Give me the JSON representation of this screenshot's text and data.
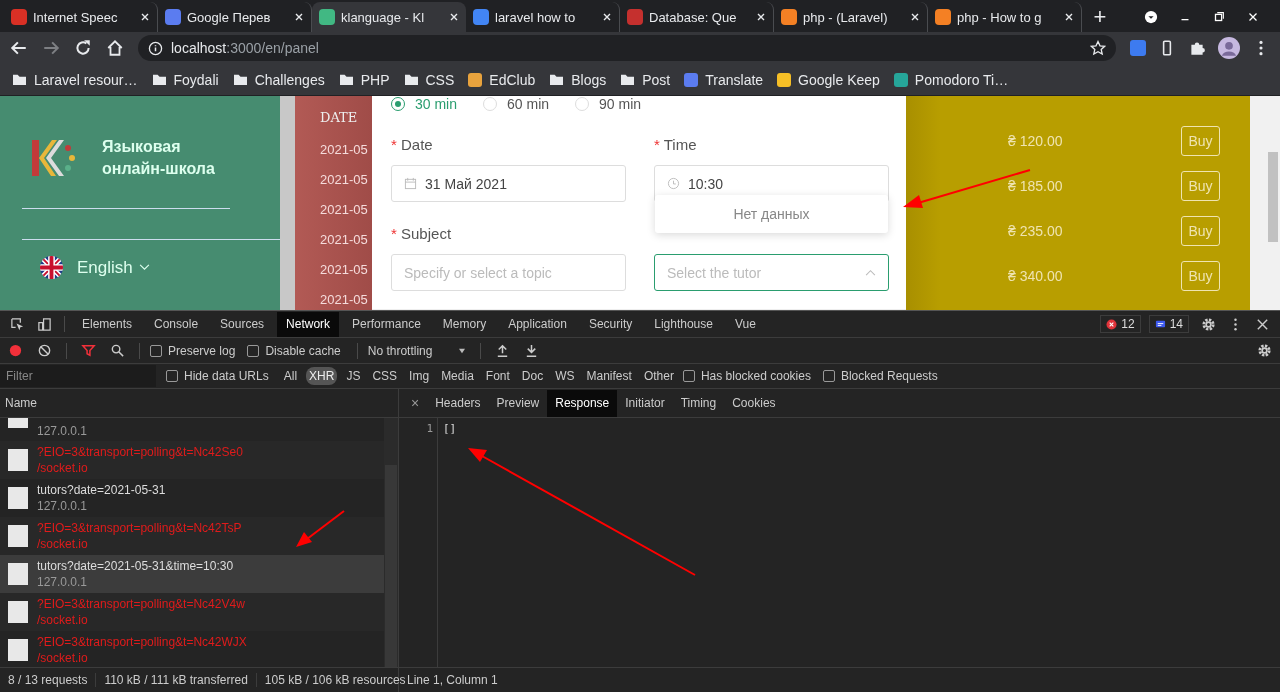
{
  "browser_tabs": [
    {
      "title": "Internet Speec",
      "selected": false,
      "color": "#d93025"
    },
    {
      "title": "Google Перев",
      "selected": false,
      "color": "#5b7cf0"
    },
    {
      "title": "klanguage - Kl",
      "selected": true,
      "color": "#41b883"
    },
    {
      "title": "laravel how to",
      "selected": false,
      "color": "#4285f4"
    },
    {
      "title": "Database: Que",
      "selected": false,
      "color": "#c5302e"
    },
    {
      "title": "php - (Laravel)",
      "selected": false,
      "color": "#f48024"
    },
    {
      "title": "php - How to g",
      "selected": false,
      "color": "#f48024"
    }
  ],
  "new_tab": "+",
  "address": {
    "host": "localhost",
    "path": ":3000/en/panel"
  },
  "bookmarks": [
    {
      "label": "Laravel resour…",
      "kind": "folder"
    },
    {
      "label": "Foydali",
      "kind": "folder"
    },
    {
      "label": "Challenges",
      "kind": "folder"
    },
    {
      "label": "PHP",
      "kind": "folder"
    },
    {
      "label": "CSS",
      "kind": "folder"
    },
    {
      "label": "EdClub",
      "kind": "site",
      "color": "#e8a33d"
    },
    {
      "label": "Blogs",
      "kind": "folder"
    },
    {
      "label": "Post",
      "kind": "folder"
    },
    {
      "label": "Translate",
      "kind": "site",
      "color": "#5b7cf0"
    },
    {
      "label": "Google Keep",
      "kind": "site",
      "color": "#f6bf26"
    },
    {
      "label": "Pomodoro Ti…",
      "kind": "site",
      "color": "#26a69a"
    }
  ],
  "sidebar": {
    "school": "Языковая онлайн-школа",
    "language": "English"
  },
  "dates_panel": {
    "heading": "DATE",
    "rows": [
      "2021-05",
      "2021-05",
      "2021-05",
      "2021-05",
      "2021-05",
      "2021-05"
    ]
  },
  "booking_form": {
    "durations": [
      {
        "label": "30 min",
        "selected": true
      },
      {
        "label": "60 min",
        "selected": false
      },
      {
        "label": "90 min",
        "selected": false
      }
    ],
    "date": {
      "mark": "*",
      "label": "Date",
      "value": "31 Май 2021"
    },
    "time": {
      "mark": "*",
      "label": "Time",
      "value": "10:30",
      "dropdown": "Нет данных"
    },
    "subject": {
      "mark": "*",
      "label": "Subject",
      "placeholder": "Specify or select a topic"
    },
    "tutor": {
      "placeholder": "Select the tutor",
      "expanded": true
    }
  },
  "prices": [
    {
      "price": "₴ 120.00",
      "button": "Buy"
    },
    {
      "price": "₴ 185.00",
      "button": "Buy"
    },
    {
      "price": "₴ 235.00",
      "button": "Buy"
    },
    {
      "price": "₴ 340.00",
      "button": "Buy"
    }
  ],
  "devtools": {
    "tabs": [
      {
        "label": "Elements",
        "selected": false
      },
      {
        "label": "Console",
        "selected": false
      },
      {
        "label": "Sources",
        "selected": false
      },
      {
        "label": "Network",
        "selected": true
      },
      {
        "label": "Performance",
        "selected": false
      },
      {
        "label": "Memory",
        "selected": false
      },
      {
        "label": "Application",
        "selected": false
      },
      {
        "label": "Security",
        "selected": false
      },
      {
        "label": "Lighthouse",
        "selected": false
      },
      {
        "label": "Vue",
        "selected": false
      }
    ],
    "errors": "12",
    "messages": "14",
    "preserve_log": {
      "label": "Preserve log",
      "checked": false
    },
    "disable_cache": {
      "label": "Disable cache",
      "checked": false
    },
    "throttling": "No throttling",
    "filter_placeholder": "Filter",
    "hide_data_urls": {
      "label": "Hide data URLs",
      "checked": false
    },
    "types": [
      {
        "label": "All",
        "selected": false
      },
      {
        "label": "XHR",
        "selected": true
      },
      {
        "label": "JS",
        "selected": false
      },
      {
        "label": "CSS",
        "selected": false
      },
      {
        "label": "Img",
        "selected": false
      },
      {
        "label": "Media",
        "selected": false
      },
      {
        "label": "Font",
        "selected": false
      },
      {
        "label": "Doc",
        "selected": false
      },
      {
        "label": "WS",
        "selected": false
      },
      {
        "label": "Manifest",
        "selected": false
      },
      {
        "label": "Other",
        "selected": false
      }
    ],
    "blocked_cookies": {
      "label": "Has blocked cookies",
      "checked": false
    },
    "blocked_requests": {
      "label": "Blocked Requests",
      "checked": false
    },
    "name_header": "Name",
    "requests": [
      {
        "domain": "127.0.0.1",
        "failed": false,
        "selected": false
      },
      {
        "name": "?EIO=3&transport=polling&t=Nc42Se0",
        "domain": "/socket.io",
        "failed": true,
        "selected": false
      },
      {
        "name": "tutors?date=2021-05-31",
        "domain": "127.0.0.1",
        "failed": false,
        "selected": false
      },
      {
        "name": "?EIO=3&transport=polling&t=Nc42TsP",
        "domain": "/socket.io",
        "failed": true,
        "selected": false
      },
      {
        "name": "tutors?date=2021-05-31&time=10:30",
        "domain": "127.0.0.1",
        "failed": false,
        "selected": true
      },
      {
        "name": "?EIO=3&transport=polling&t=Nc42V4w",
        "domain": "/socket.io",
        "failed": true,
        "selected": false
      },
      {
        "name": "?EIO=3&transport=polling&t=Nc42WJX",
        "domain": "/socket.io",
        "failed": true,
        "selected": false
      }
    ],
    "detail_close": "×",
    "detail_tabs": [
      {
        "label": "Headers",
        "selected": false
      },
      {
        "label": "Preview",
        "selected": false
      },
      {
        "label": "Response",
        "selected": true
      },
      {
        "label": "Initiator",
        "selected": false
      },
      {
        "label": "Timing",
        "selected": false
      },
      {
        "label": "Cookies",
        "selected": false
      }
    ],
    "response_lines": [
      {
        "number": "1",
        "code": "[]"
      }
    ],
    "status": [
      "8 / 13 requests",
      "110 kB / 111 kB transferred",
      "105 kB / 106 kB resources"
    ],
    "cursor": "Line 1, Column 1"
  }
}
